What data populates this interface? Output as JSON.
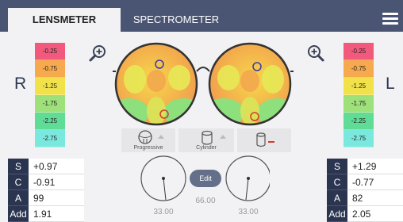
{
  "tabs": {
    "lensmeter": "LENSMETER",
    "spectrometer": "SPECTROMETER"
  },
  "sides": {
    "right": "R",
    "left": "L"
  },
  "scale": {
    "values": [
      "-0.25",
      "-0.75",
      "-1.25",
      "-1.75",
      "-2.25",
      "-2.75"
    ],
    "colors": [
      "#f25a7d",
      "#f7a94d",
      "#f2e24a",
      "#9ee07a",
      "#5fdd96",
      "#7be8de"
    ]
  },
  "modes": {
    "progressive": "Progressive",
    "cylinder": "Cylinder"
  },
  "right_lens": {
    "labels": [
      "S",
      "C",
      "A",
      "Add"
    ],
    "values": [
      "+0.97",
      "-0.91",
      "99",
      "1.91"
    ]
  },
  "left_lens": {
    "labels": [
      "S",
      "C",
      "A",
      "Add"
    ],
    "values": [
      "+1.29",
      "-0.77",
      "82",
      "2.05"
    ]
  },
  "axis": {
    "right": "33.00",
    "pd": "66.00",
    "left": "33.00"
  },
  "edit_label": "Edit",
  "icons": {
    "menu": "menu-icon",
    "zoom_in": "zoom-in-icon",
    "progressive": "progressive-lens-icon",
    "cylinder": "cylinder-icon",
    "cylinder_minus": "cylinder-minus-icon"
  },
  "colors": {
    "accent": "#4a5473",
    "dark": "#2b3550",
    "marker_red": "#d53b2a",
    "marker_blue": "#3a3aa8"
  }
}
